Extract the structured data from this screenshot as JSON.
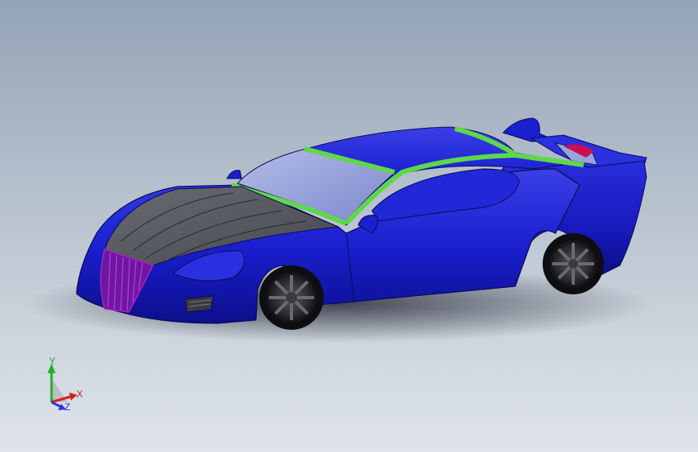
{
  "viewport": {
    "background_top": "#94a2b7",
    "background_bottom": "#dfe4ea"
  },
  "model": {
    "body_color": "#1a1fd0",
    "hood_color": "#5a5c66",
    "glass_color": "#9aa4dc",
    "trim_color": "#5ed84a",
    "grille_color": "#b81ec8",
    "wheel_color": "#2a2a2e"
  },
  "triad": {
    "x_label": "X",
    "y_label": "Y",
    "z_label": "Z",
    "x_color": "#d42020",
    "y_color": "#22b022",
    "z_color": "#2a3ad0"
  }
}
